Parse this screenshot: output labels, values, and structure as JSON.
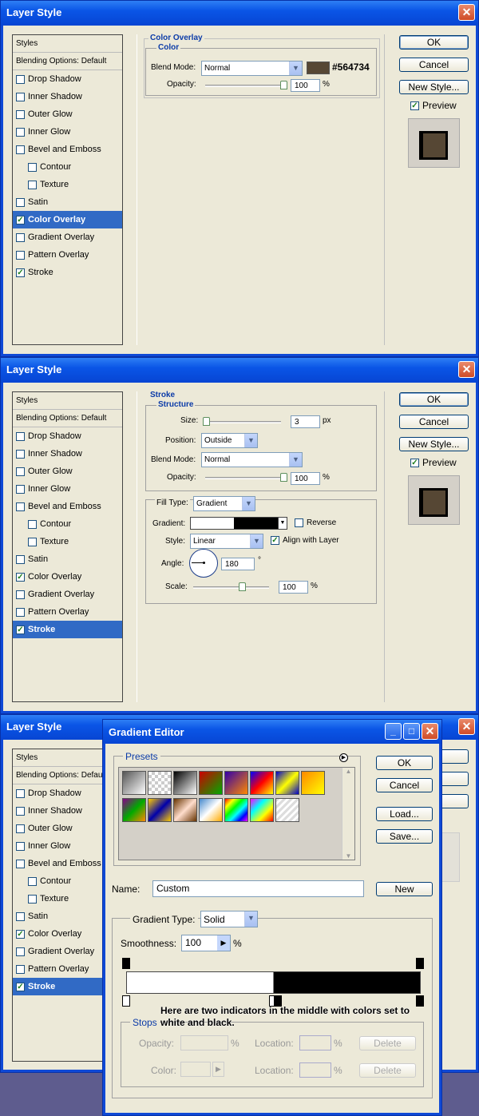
{
  "dialog": {
    "title": "Layer Style",
    "close_glyph": "✕",
    "styles_header": "Styles",
    "blending_options": "Blending Options: Default",
    "effects": [
      "Drop Shadow",
      "Inner Shadow",
      "Outer Glow",
      "Inner Glow",
      "Bevel and Emboss",
      "Contour",
      "Texture",
      "Satin",
      "Color Overlay",
      "Gradient Overlay",
      "Pattern Overlay",
      "Stroke"
    ],
    "buttons": {
      "ok": "OK",
      "cancel": "Cancel",
      "new_style": "New Style..."
    },
    "preview_label": "Preview",
    "preview_color": "#564734"
  },
  "color_overlay": {
    "section_title": "Color Overlay",
    "group_title": "Color",
    "blend_mode_label": "Blend Mode:",
    "blend_mode": "Normal",
    "color_hex": "#564734",
    "opacity_label": "Opacity:",
    "opacity": "100",
    "pct": "%"
  },
  "stroke": {
    "section_title": "Stroke",
    "structure_title": "Structure",
    "size_label": "Size:",
    "size": "3",
    "size_unit": "px",
    "position_label": "Position:",
    "position": "Outside",
    "blend_mode_label": "Blend Mode:",
    "blend_mode": "Normal",
    "opacity_label": "Opacity:",
    "opacity": "100",
    "pct": "%",
    "fill_type_label": "Fill Type:",
    "fill_type": "Gradient",
    "gradient_label": "Gradient:",
    "reverse_label": "Reverse",
    "style_label": "Style:",
    "style": "Linear",
    "align_label": "Align with Layer",
    "angle_label": "Angle:",
    "angle": "180",
    "deg": "°",
    "scale_label": "Scale:",
    "scale": "100"
  },
  "gradient_editor": {
    "title": "Gradient Editor",
    "presets_label": "Presets",
    "buttons": {
      "ok": "OK",
      "cancel": "Cancel",
      "load": "Load...",
      "save": "Save...",
      "new": "New",
      "delete": "Delete"
    },
    "name_label": "Name:",
    "name": "Custom",
    "gradient_type_label": "Gradient Type:",
    "gradient_type": "Solid",
    "smoothness_label": "Smoothness:",
    "smoothness": "100",
    "pct": "%",
    "stops_label": "Stops",
    "opacity_label": "Opacity:",
    "location_label": "Location:",
    "color_label": "Color:",
    "stop_colors": [
      "#ffffff",
      "#000000"
    ]
  },
  "annotation": "Here are two indicators in the middle with colors set to white and black."
}
